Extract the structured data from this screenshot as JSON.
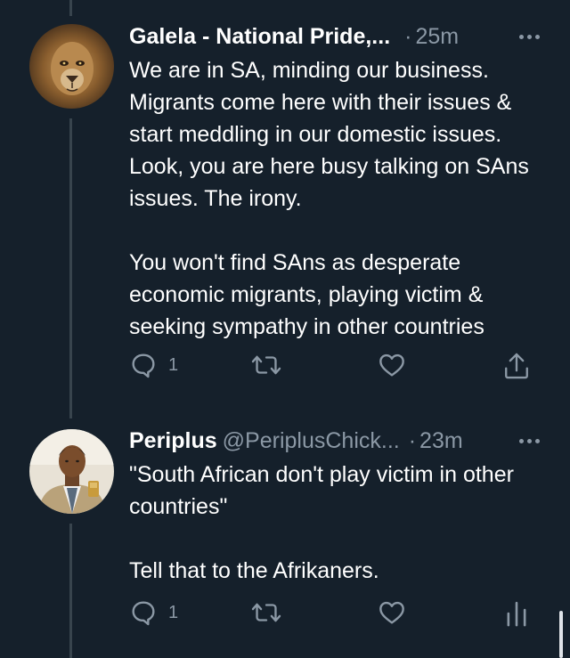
{
  "tweets": [
    {
      "display_name": "Galela - National Pride,...",
      "handle": "",
      "time_prefix": "·",
      "time": "25m",
      "text": "We are in SA, minding our business. Migrants come here with their issues & start meddling in our domestic issues. Look, you are here busy talking on SAns issues. The irony.\n\nYou won't find SAns as desperate economic migrants, playing victim & seeking sympathy in other countries",
      "reply_count": "1",
      "avatar_icon": "lion-avatar",
      "last_action_icon": "share-icon"
    },
    {
      "display_name": "Periplus",
      "handle": "@PeriplusChick...",
      "time_prefix": "·",
      "time": "23m",
      "text": "\"South African don't play victim in other countries\"\n\nTell that to the Afrikaners.",
      "reply_count": "1",
      "avatar_icon": "person-avatar",
      "last_action_icon": "analytics-icon"
    }
  ],
  "colors": {
    "background": "#15202b",
    "text": "#ffffff",
    "secondary_text": "#8b98a5",
    "thread_line": "#38444d"
  }
}
